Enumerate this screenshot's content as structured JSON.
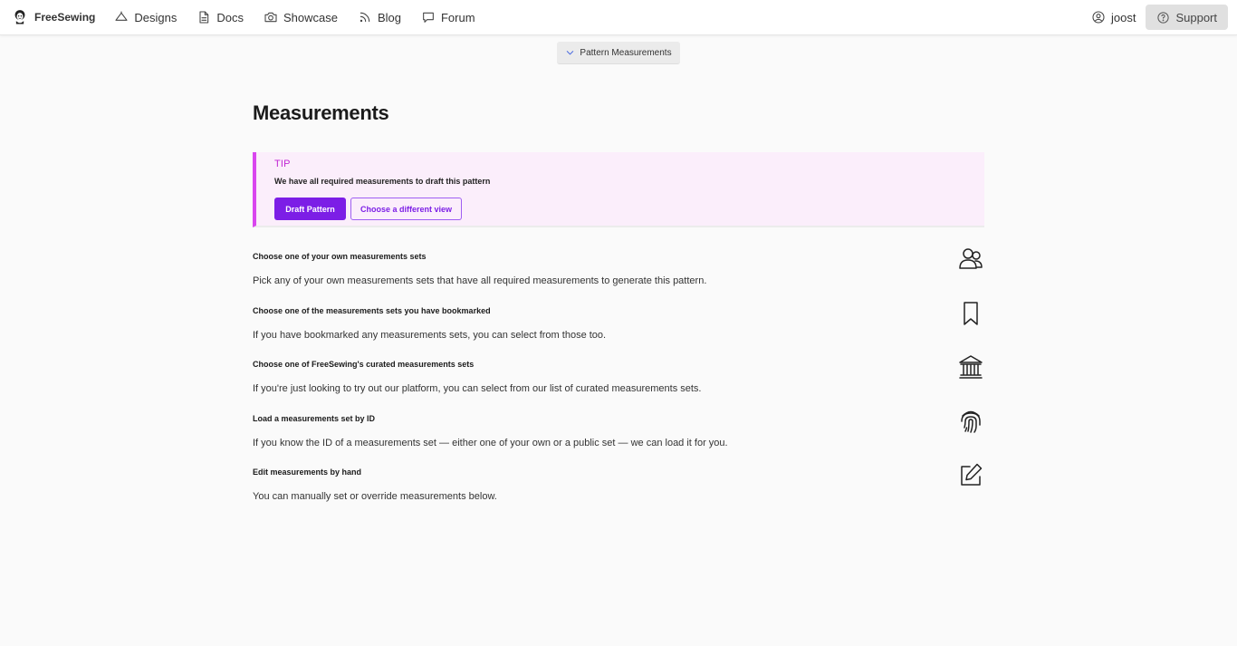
{
  "nav": {
    "brand": "FreeSewing",
    "items": [
      {
        "label": "Designs",
        "icon": "designs-icon"
      },
      {
        "label": "Docs",
        "icon": "docs-icon"
      },
      {
        "label": "Showcase",
        "icon": "camera-icon"
      },
      {
        "label": "Blog",
        "icon": "rss-icon"
      },
      {
        "label": "Forum",
        "icon": "chat-icon"
      }
    ],
    "user": "joost",
    "support": "Support"
  },
  "pattern_toggle": {
    "label": "Pattern Measurements",
    "icon": "chevron-down-icon"
  },
  "page": {
    "title": "Measurements"
  },
  "tip": {
    "label": "TIP",
    "text": "We have all required measurements to draft this pattern",
    "primary_button": "Draft Pattern",
    "secondary_button": "Choose a different view"
  },
  "options": [
    {
      "title": "Choose one of your own measurements sets",
      "description": "Pick any of your own measurements sets that have all required measurements to generate this pattern.",
      "icon": "users-icon"
    },
    {
      "title": "Choose one of the measurements sets you have bookmarked",
      "description": "If you have bookmarked any measurements sets, you can select from those too.",
      "icon": "bookmark-icon"
    },
    {
      "title": "Choose one of FreeSewing's curated measurements sets",
      "description": "If you're just looking to try out our platform, you can select from our list of curated measurements sets.",
      "icon": "bank-icon"
    },
    {
      "title": "Load a measurements set by ID",
      "description": "If you know the ID of a measurements set — either one of your own or a public set — we can load it for you.",
      "icon": "fingerprint-icon"
    },
    {
      "title": "Edit measurements by hand",
      "description": "You can manually set or override measurements below.",
      "icon": "edit-icon"
    }
  ],
  "colors": {
    "accent": "#7c1ee6",
    "tip_border": "#d946ef",
    "tip_background": "#fbeefb"
  }
}
